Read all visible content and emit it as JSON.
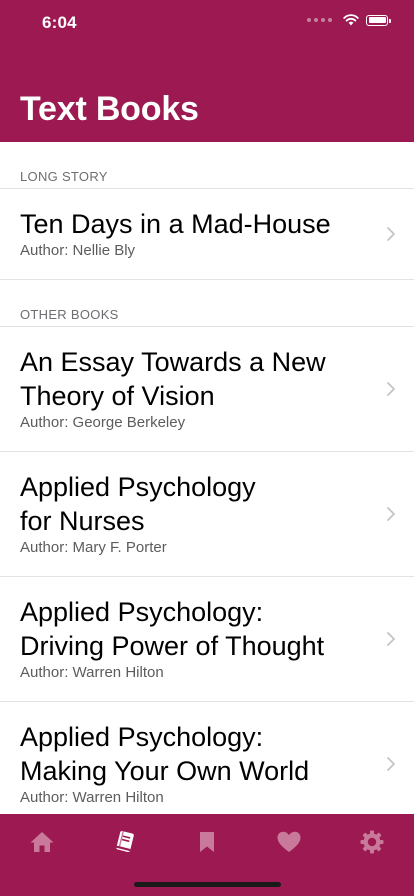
{
  "status": {
    "time": "6:04"
  },
  "header": {
    "title": "Text Books"
  },
  "sections": [
    {
      "header": "LONG STORY",
      "books": [
        {
          "title": "Ten Days in a Mad-House",
          "author": "Author: Nellie Bly"
        }
      ]
    },
    {
      "header": "OTHER BOOKS",
      "books": [
        {
          "title_line1": "An Essay Towards a New",
          "title_line2": "Theory of Vision",
          "author": "Author: George Berkeley"
        },
        {
          "title_line1": "Applied Psychology",
          "title_line2": "for Nurses",
          "author": "Author: Mary F. Porter"
        },
        {
          "title_line1": "Applied Psychology:",
          "title_line2": "Driving Power of Thought",
          "author": "Author: Warren Hilton"
        },
        {
          "title_line1": "Applied Psychology:",
          "title_line2": "Making Your Own World",
          "author": "Author: Warren Hilton"
        }
      ]
    }
  ],
  "tabbar": {
    "tabs": [
      "home-icon",
      "book-icon",
      "bookmark-icon",
      "heart-icon",
      "gear-icon"
    ],
    "active": "book-icon",
    "active_color": "#ffffff",
    "inactive_color": "#c97a9a"
  },
  "colors": {
    "brand": "#9c1a51"
  }
}
